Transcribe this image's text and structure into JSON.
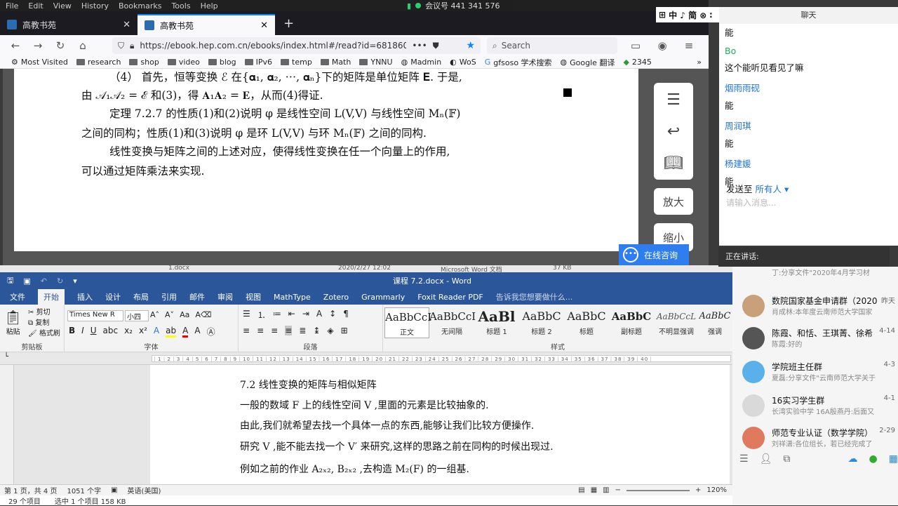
{
  "browser": {
    "menu": [
      "File",
      "Edit",
      "View",
      "History",
      "Bookmarks",
      "Tools",
      "Help"
    ],
    "meeting_label": "会议号 441 341 576",
    "tabs": [
      {
        "label": "高教书苑"
      },
      {
        "label": "高教书苑"
      }
    ],
    "url": "https://ebook.hep.com.cn/ebooks/index.html#/read?id=6818608",
    "search_placeholder": "Search",
    "bookmarks": [
      "Most Visited",
      "research",
      "shop",
      "video",
      "blog",
      "IPv6",
      "temp",
      "Math",
      "YNNU",
      "Madmin",
      "WoS",
      "gfsoso 学术搜索",
      "Google 翻译",
      "2345"
    ]
  },
  "ebook": {
    "lines": [
      "（4） 首先，恒等变换 ℰ 在{𝛂₁, 𝛂₂, ⋯, 𝛂ₙ}下的矩阵是单位矩阵 𝐄. 于是,",
      "由 𝒜₁𝒜₂ = ℰ 和(3)，得 𝐀₁𝐀₂ = 𝐄，从而(4)得证.",
      "定理 7.2.7 的性质(1)和(2)说明 φ 是线性空间 L(V,V) 与线性空间 Mₙ(𝔽)",
      "之间的同构；性质(1)和(3)说明 φ 是环 L(V,V) 与环 Mₙ(𝔽) 之间的同构.",
      "线性变换与矩阵之间的上述对应，使得线性变换在任一个向量上的作用,",
      "可以通过矩阵乘法来实现."
    ],
    "side_buttons": {
      "zoom_in": "放大",
      "zoom_out": "缩小"
    },
    "consult": "在线咨询"
  },
  "word": {
    "title": "课程 7.2.docx - Word",
    "tabs": [
      "文件",
      "开始",
      "插入",
      "设计",
      "布局",
      "引用",
      "邮件",
      "审阅",
      "视图",
      "MathType",
      "Zotero",
      "Grammarly",
      "Foxit Reader PDF"
    ],
    "tell_me": "告诉我您想要做什么...",
    "clipboard": {
      "paste": "粘贴",
      "cut": "剪切",
      "copy": "复制",
      "painter": "格式刷",
      "label": "剪贴板"
    },
    "font": {
      "name": "Times New R",
      "size": "小四",
      "label": "字体"
    },
    "paragraph_label": "段落",
    "styles_label": "样式",
    "styles": [
      {
        "sample": "AaBbCcI",
        "name": "正文"
      },
      {
        "sample": "AaBbCcI",
        "name": "无间隔"
      },
      {
        "sample": "AaBl",
        "name": "标题 1"
      },
      {
        "sample": "AaBbC",
        "name": "标题 2"
      },
      {
        "sample": "AaBbC",
        "name": "标题"
      },
      {
        "sample": "AaBbC",
        "name": "副标题"
      },
      {
        "sample": "AaBbCcL",
        "name": "不明显强调"
      },
      {
        "sample": "AaBbC",
        "name": "强调"
      }
    ],
    "doc_lines": [
      "7.2  线性变换的矩阵与相似矩阵",
      "一般的数域 F 上的线性空间 V ,里面的元素是比较抽象的.",
      "由此,我们就希望去找一个具体一点的东西,能够让我们比较方便操作.",
      "研究 V ,能不能去找一个 V′ 来研究,这样的思路之前在同构的时候出现过.",
      "例如之前的作业 A₂ₓ₂, B₂ₓ₂ ,去构造 M₂(F) 的一组基."
    ],
    "status": {
      "page": "第 1 页，共 4 页",
      "words": "1051 个字",
      "lang": "英语(美国)",
      "zoom": "120%"
    }
  },
  "explorer": {
    "items": "29 个项目",
    "selected": "选中 1 个项目  158 KB",
    "row": [
      "1.docx",
      "2020/2/27 12:02",
      "Microsoft Word 文档",
      "37 KB"
    ]
  },
  "chat": {
    "title": "聊天",
    "messages": [
      {
        "name": "",
        "text": "能"
      },
      {
        "name": "Bo",
        "text": "这个能听见看见了嘛"
      },
      {
        "name": "烟雨雨砚",
        "text": "能"
      },
      {
        "name": "周润琪",
        "text": "能"
      },
      {
        "name": "杨建媛",
        "text": "能"
      }
    ],
    "send_to": "发送至",
    "recipient": "所有人",
    "input_placeholder": "请输入消息...",
    "speaking": "正在讲话:",
    "toolbar": "中 ♪ 简 ⊗ ∶"
  },
  "qq": {
    "items": [
      {
        "name": "数院国家基金申请群（2020",
        "sub": "肖成林:本年度云南师范大学国家",
        "time": "昨天"
      },
      {
        "name": "陈霞、和恬、王琪菁、徐希",
        "sub": "陈霞:好的",
        "time": "4-14"
      },
      {
        "name": "学院班主任群",
        "sub": "夏磊:分享文件\"云南师范大学关于",
        "time": "4-3"
      },
      {
        "name": "16实习学生群",
        "sub": "长湾实验中学 16A殷燕丹:后面又",
        "time": "4-1"
      },
      {
        "name": "师范专业认证（数学学院）",
        "sub": "刘祥潇:各位组长，若已经完成了",
        "time": "2-29"
      }
    ],
    "top_partial": "丁:分享文件\"2020年4月学习材"
  }
}
